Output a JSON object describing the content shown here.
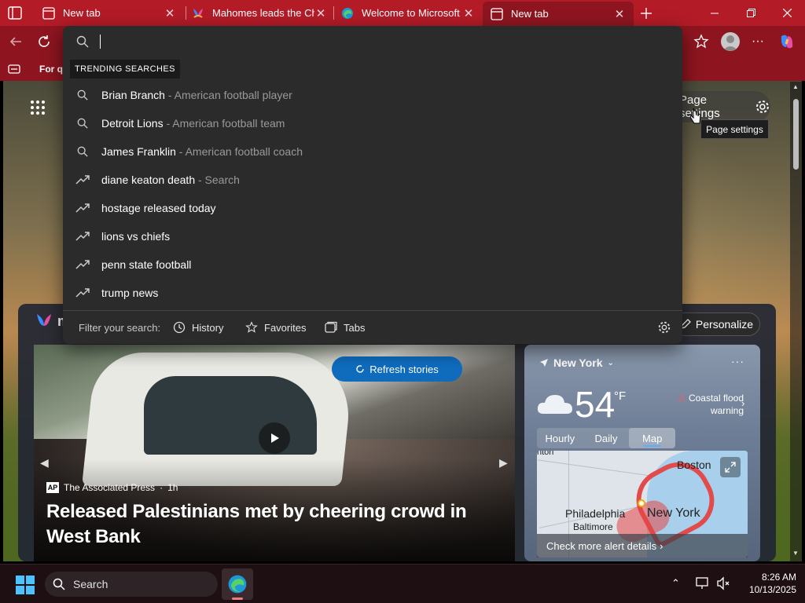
{
  "tabs": [
    {
      "title": "New tab",
      "active": false
    },
    {
      "title": "Mahomes leads the Chi",
      "active": false
    },
    {
      "title": "Welcome to Microsoft E",
      "active": false
    },
    {
      "title": "New tab",
      "active": true
    }
  ],
  "favorites_bar": {
    "item": "For qu"
  },
  "page": {
    "settings_label": "Page settings",
    "tooltip": "Page settings",
    "feed_logo_text": "m",
    "personalize_label": "Personalize",
    "refresh_label": "Refresh stories",
    "hero": {
      "source": "The Associated Press",
      "time": "1h",
      "source_badge": "AP",
      "headline": "Released Palestinians met by cheering crowd in West Bank"
    },
    "weather": {
      "location": "New York",
      "temp": "54",
      "unit": "°F",
      "alert": "Coastal flood warning",
      "tabs": [
        "Hourly",
        "Daily",
        "Map"
      ],
      "selected_tab": "Map",
      "map_labels": {
        "boston": "Boston",
        "philadelphia": "Philadelphia",
        "baltimore": "Baltimore",
        "new_york": "New York",
        "top_left": "nton"
      },
      "check_alerts": "Check more alert details"
    }
  },
  "search": {
    "query": "",
    "trending_label": "TRENDING SEARCHES",
    "suggestions": [
      {
        "text": "Brian Branch",
        "sub": " - American football player",
        "icon": "search-icon"
      },
      {
        "text": "Detroit Lions",
        "sub": " - American football team",
        "icon": "search-icon"
      },
      {
        "text": "James Franklin",
        "sub": " - American football coach",
        "icon": "search-icon"
      },
      {
        "text": "diane keaton death",
        "sub": " - Search",
        "icon": "trending-icon"
      },
      {
        "text": "hostage released today",
        "sub": "",
        "icon": "trending-icon"
      },
      {
        "text": "lions vs chiefs",
        "sub": "",
        "icon": "trending-icon"
      },
      {
        "text": "penn state football",
        "sub": "",
        "icon": "trending-icon"
      },
      {
        "text": "trump news",
        "sub": "",
        "icon": "trending-icon"
      }
    ],
    "filter_label": "Filter your search:",
    "filters": [
      "History",
      "Favorites",
      "Tabs"
    ]
  },
  "taskbar": {
    "search_label": "Search",
    "time": "8:26 AM",
    "date": "10/13/2025"
  },
  "colors": {
    "titlebar": "#b31b27",
    "toolbar": "#8e1520",
    "accent_blue": "#0f6cbd",
    "dropdown_bg": "#2b2b2b"
  }
}
